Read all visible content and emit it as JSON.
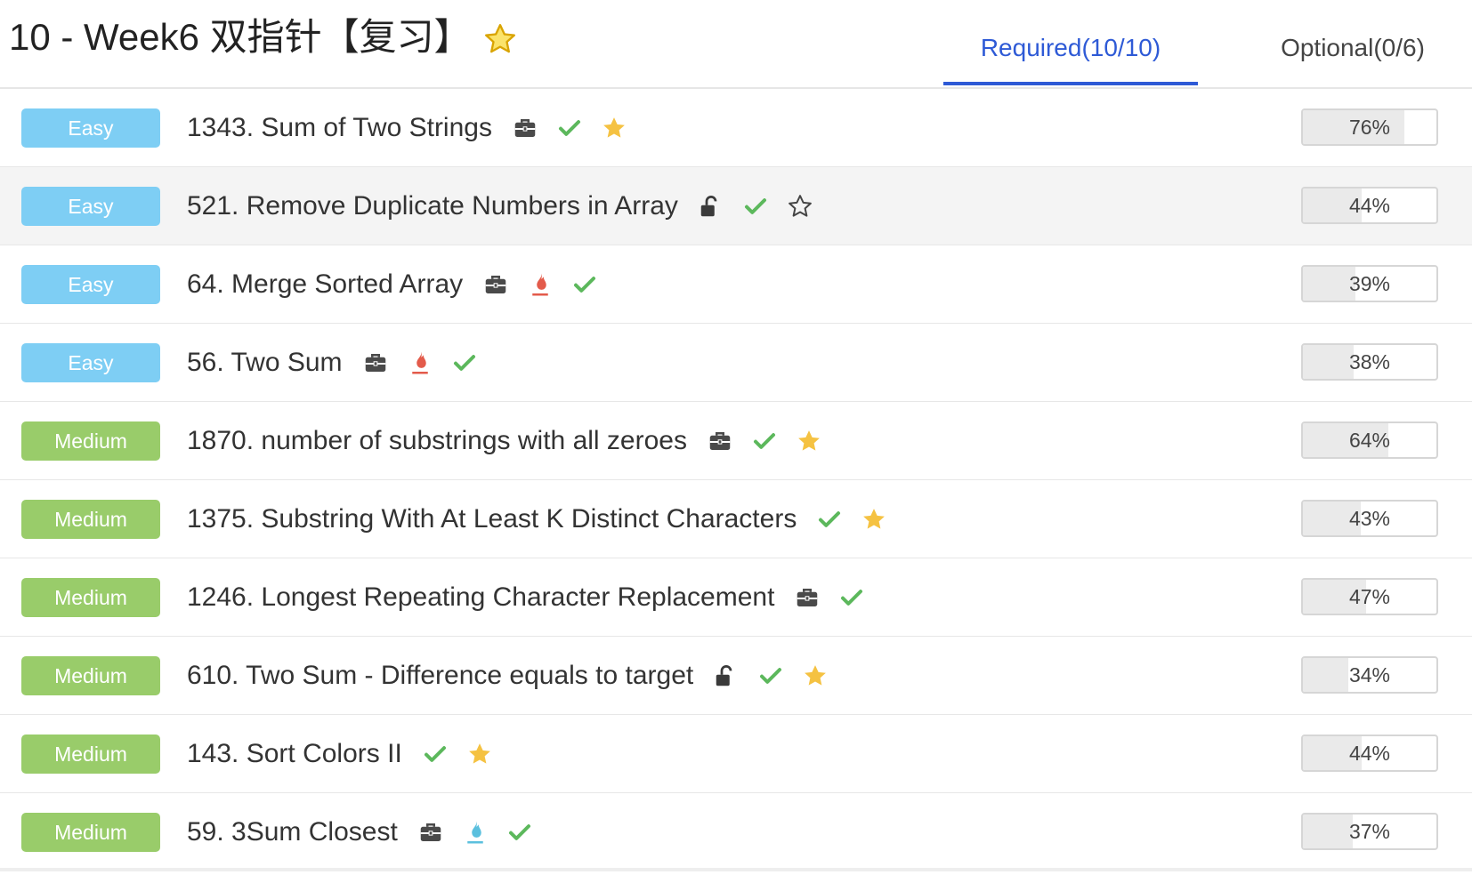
{
  "header": {
    "title": "10 - Week6 双指针【复习】",
    "tabs": [
      {
        "label": "Required(10/10)",
        "active": true
      },
      {
        "label": "Optional(0/6)",
        "active": false
      }
    ]
  },
  "colors": {
    "accent": "#2e5ad6",
    "easy": "#7ecef4",
    "medium": "#99cc6a",
    "check": "#5cb85c",
    "star": "#f5c242",
    "hot": "#e35b4b",
    "cool": "#5bc0de"
  },
  "problems": [
    {
      "difficulty": "Easy",
      "title": "1343. Sum of Two Strings",
      "icons": [
        "briefcase-icon",
        "check-icon",
        "star-filled-icon"
      ],
      "progress_label": "76%",
      "progress": 0.76
    },
    {
      "difficulty": "Easy",
      "title": "521. Remove Duplicate Numbers in Array",
      "icons": [
        "unlock-icon",
        "check-icon",
        "star-outline-icon"
      ],
      "progress_label": "44%",
      "progress": 0.44
    },
    {
      "difficulty": "Easy",
      "title": "64. Merge Sorted Array",
      "icons": [
        "briefcase-icon",
        "flame-red-icon",
        "check-icon"
      ],
      "progress_label": "39%",
      "progress": 0.39
    },
    {
      "difficulty": "Easy",
      "title": "56. Two Sum",
      "icons": [
        "briefcase-icon",
        "flame-red-icon",
        "check-icon"
      ],
      "progress_label": "38%",
      "progress": 0.38
    },
    {
      "difficulty": "Medium",
      "title": "1870. number of substrings with all zeroes",
      "icons": [
        "briefcase-icon",
        "check-icon",
        "star-filled-icon"
      ],
      "progress_label": "64%",
      "progress": 0.64
    },
    {
      "difficulty": "Medium",
      "title": "1375. Substring With At Least K Distinct Characters",
      "icons": [
        "check-icon",
        "star-filled-icon"
      ],
      "progress_label": "43%",
      "progress": 0.43
    },
    {
      "difficulty": "Medium",
      "title": "1246. Longest Repeating Character Replacement",
      "icons": [
        "briefcase-icon",
        "check-icon"
      ],
      "progress_label": "47%",
      "progress": 0.47
    },
    {
      "difficulty": "Medium",
      "title": "610. Two Sum - Difference equals to target",
      "icons": [
        "unlock-icon",
        "check-icon",
        "star-filled-icon"
      ],
      "progress_label": "34%",
      "progress": 0.34
    },
    {
      "difficulty": "Medium",
      "title": "143. Sort Colors II",
      "icons": [
        "check-icon",
        "star-filled-icon"
      ],
      "progress_label": "44%",
      "progress": 0.44
    },
    {
      "difficulty": "Medium",
      "title": "59. 3Sum Closest",
      "icons": [
        "briefcase-icon",
        "flame-blue-icon",
        "check-icon"
      ],
      "progress_label": "37%",
      "progress": 0.37
    }
  ]
}
